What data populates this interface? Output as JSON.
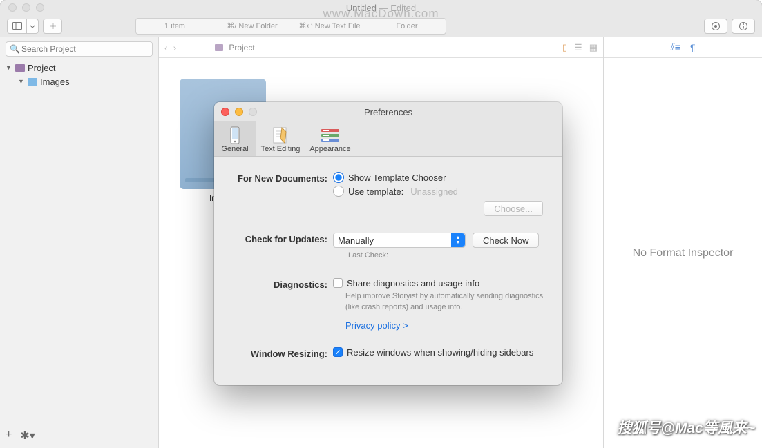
{
  "window": {
    "title": "Untitled",
    "title_suffix": " — Edited"
  },
  "toolbar": {
    "item_count": "1 item",
    "new_folder": "⌘/ New Folder",
    "new_text_file": "⌘↩ New Text File",
    "folder_label": "Folder"
  },
  "sidebar": {
    "search_placeholder": "Search Project",
    "root": "Project",
    "child": "Images"
  },
  "breadcrumb": {
    "project": "Project"
  },
  "folder_thumb": {
    "label": "Images"
  },
  "inspector": {
    "empty": "No Format Inspector"
  },
  "prefs": {
    "title": "Preferences",
    "tabs": {
      "general": "General",
      "text_editing": "Text Editing",
      "appearance": "Appearance"
    },
    "new_docs": {
      "label": "For New Documents:",
      "show_chooser": "Show Template Chooser",
      "use_template": "Use template:",
      "unassigned": "Unassigned",
      "choose": "Choose..."
    },
    "updates": {
      "label": "Check for Updates:",
      "mode": "Manually",
      "check_now": "Check Now",
      "last_check": "Last Check:"
    },
    "diagnostics": {
      "label": "Diagnostics:",
      "share": "Share diagnostics and usage info",
      "hint": "Help improve Storyist by automatically sending diagnostics (like crash reports) and usage info.",
      "privacy": "Privacy policy >"
    },
    "resizing": {
      "label": "Window Resizing:",
      "text": "Resize windows when showing/hiding sidebars"
    }
  },
  "watermarks": {
    "top": "www.MacDown.com",
    "bottom": "搜狐号@Mac等風来~"
  }
}
